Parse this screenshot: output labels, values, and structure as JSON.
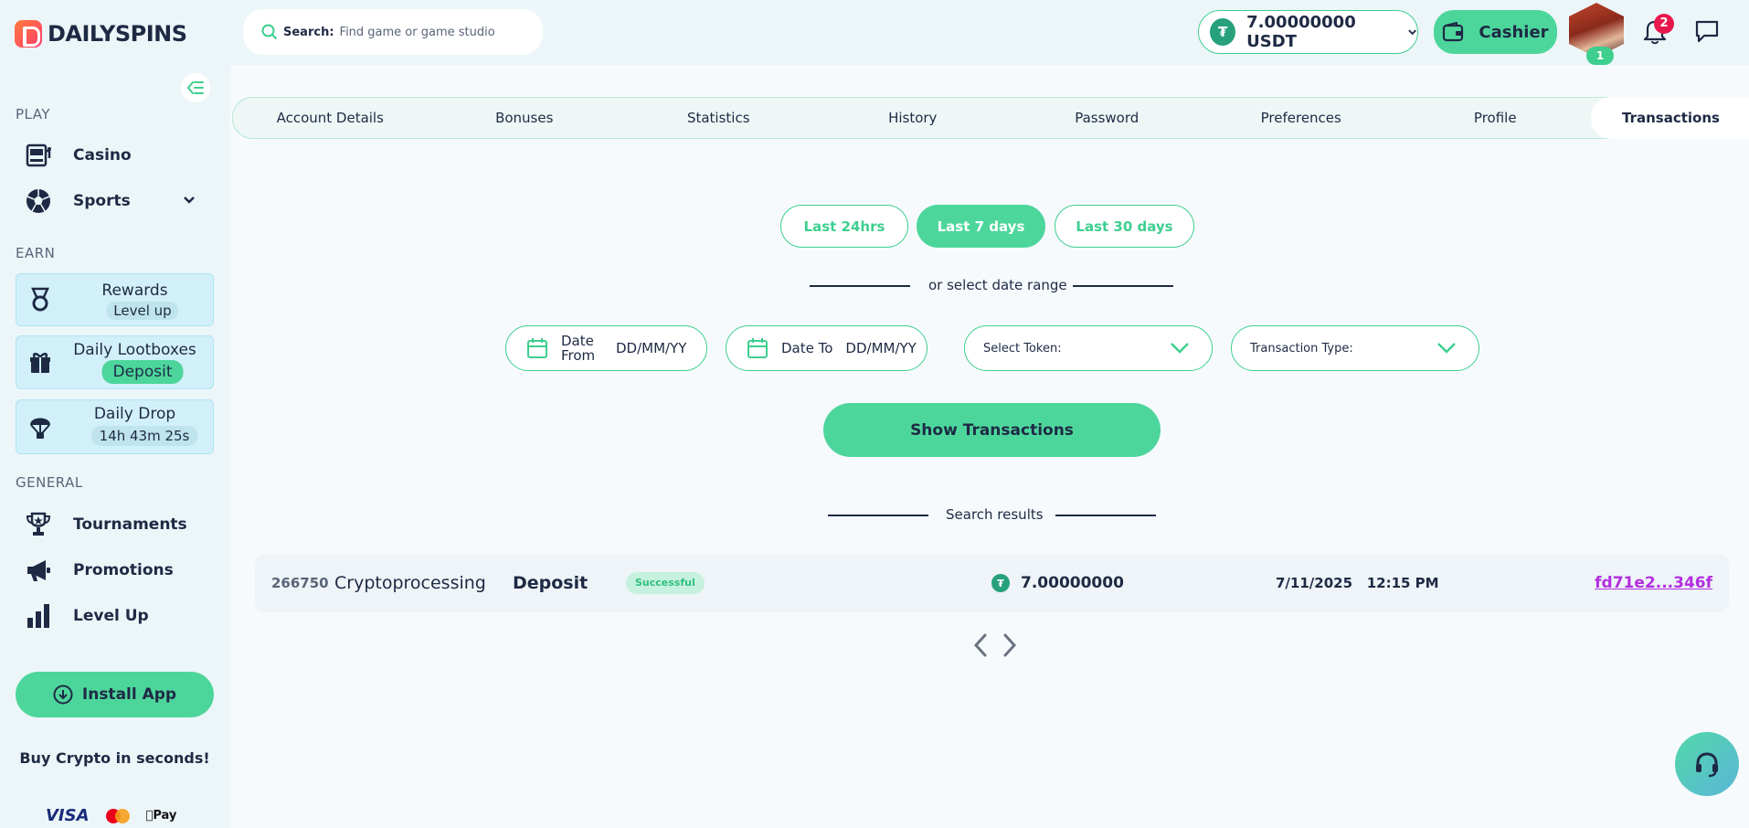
{
  "brand": {
    "name": "DAILYSPINS"
  },
  "search": {
    "label": "Search:",
    "placeholder": "Find game or game studio"
  },
  "header": {
    "balance": "7.00000000 USDT",
    "cashier_label": "Cashier",
    "avatar_level": "1",
    "notifications_count": "2"
  },
  "sidebar": {
    "play_label": "PLAY",
    "play_items": [
      {
        "label": "Casino"
      },
      {
        "label": "Sports"
      }
    ],
    "earn_label": "EARN",
    "earn_items": [
      {
        "label": "Rewards",
        "pill": "Level up"
      },
      {
        "label": "Daily Lootboxes",
        "pill": "Deposit"
      },
      {
        "label": "Daily Drop",
        "pill": "14h 43m 25s"
      }
    ],
    "general_label": "GENERAL",
    "general_items": [
      {
        "label": "Tournaments"
      },
      {
        "label": "Promotions"
      },
      {
        "label": "Level Up"
      }
    ],
    "install_label": "Install App",
    "buy_crypto": "Buy Crypto in seconds!",
    "payments": {
      "visa": "VISA",
      "apple_pay": "Pay"
    }
  },
  "tabs": [
    {
      "label": "Account Details"
    },
    {
      "label": "Bonuses"
    },
    {
      "label": "Statistics"
    },
    {
      "label": "History"
    },
    {
      "label": "Password"
    },
    {
      "label": "Preferences"
    },
    {
      "label": "Profile"
    },
    {
      "label": "Transactions",
      "active": true
    }
  ],
  "filters": {
    "periods": [
      {
        "label": "Last 24hrs",
        "active": false
      },
      {
        "label": "Last 7 days",
        "active": true
      },
      {
        "label": "Last 30 days",
        "active": false
      }
    ],
    "range_divider": "or select date range",
    "date_from": {
      "label": "Date From",
      "placeholder": "DD/MM/YY"
    },
    "date_to": {
      "label": "Date To",
      "placeholder": "DD/MM/YY"
    },
    "token_select": "Select Token:",
    "type_select": "Transaction Type:",
    "show_button": "Show Transactions"
  },
  "results": {
    "divider": "Search results",
    "rows": [
      {
        "id": "266750",
        "provider": "Cryptoprocessing",
        "type": "Deposit",
        "status": "Successful",
        "amount": "7.00000000",
        "date": "7/11/2025",
        "time": "12:15 PM",
        "hash": "fd71e2...346f"
      }
    ]
  },
  "colors": {
    "accent": "#4dd69c",
    "accent_dark": "#3ecf8e",
    "text": "#1e2a44",
    "link": "#b32ee0",
    "badge": "#e8184c"
  }
}
